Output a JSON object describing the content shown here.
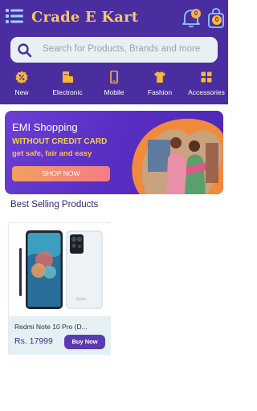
{
  "header": {
    "brand": "Crade E Kart",
    "notifications_count": "0",
    "cart_count": "0",
    "bg_color": "#4a2ea0",
    "brand_color": "#f4c868"
  },
  "search": {
    "placeholder": "Search for Products, Brands and more"
  },
  "categories": [
    {
      "label": "New",
      "icon": "percent-badge-icon"
    },
    {
      "label": "Electronic",
      "icon": "appliance-icon"
    },
    {
      "label": "Mobile",
      "icon": "mobile-phone-icon"
    },
    {
      "label": "Fashion",
      "icon": "tshirt-icon"
    },
    {
      "label": "Accessories",
      "icon": "grid-icon"
    }
  ],
  "banner": {
    "title": "EMI Shopping",
    "subtitle": "WITHOUT CREDIT CARD",
    "tagline": "get safe, fair and easy",
    "cta": "SHOP NOW"
  },
  "section": {
    "title": "Best Selling Products"
  },
  "products": [
    {
      "name": "Redmi Note 10 Pro (D...",
      "price": "Rs. 17999",
      "cta": "Buy Now"
    }
  ]
}
